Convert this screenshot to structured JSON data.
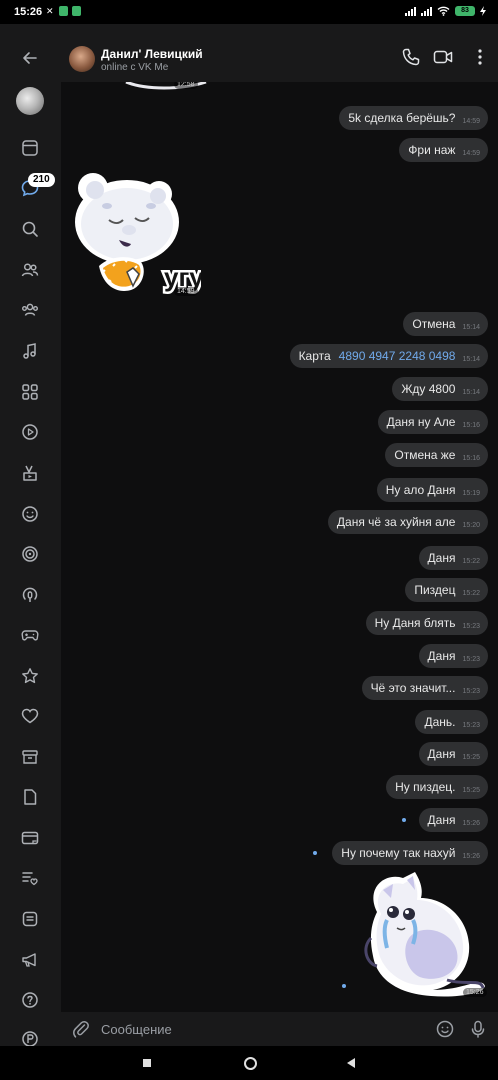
{
  "status_bar": {
    "time": "15:26",
    "battery": "83"
  },
  "sidebar": {
    "badge": "210"
  },
  "header": {
    "contact_name": "Данил' Левицкий",
    "contact_status": "online с VK Me"
  },
  "messages": [
    {
      "text": "5k сделка берёшь?",
      "time": "14:59"
    },
    {
      "text": "Фри наж",
      "time": "14:59"
    },
    {
      "text": "Отмена",
      "time": "15:14"
    },
    {
      "text": "Карта",
      "card": "4890 4947 2248 0498",
      "time": "15:14"
    },
    {
      "text": "Жду 4800",
      "time": "15:14"
    },
    {
      "text": "Даня ну Але",
      "time": "15:16"
    },
    {
      "text": "Отмена же",
      "time": "15:16"
    },
    {
      "text": "Ну ало Даня",
      "time": "15:19"
    },
    {
      "text": "Даня чё за хуйня але",
      "time": "15:20"
    },
    {
      "text": "Даня",
      "time": "15:22"
    },
    {
      "text": "Пиздец",
      "time": "15:22"
    },
    {
      "text": "Ну Даня блять",
      "time": "15:23"
    },
    {
      "text": "Даня",
      "time": "15:23"
    },
    {
      "text": "Чё это значит...",
      "time": "15:23"
    },
    {
      "text": "Дань.",
      "time": "15:23"
    },
    {
      "text": "Даня",
      "time": "15:25"
    },
    {
      "text": "Ну пиздец.",
      "time": "15:25"
    },
    {
      "text": "Даня",
      "time": "15:26"
    },
    {
      "text": "Ну почему так нахуй",
      "time": "15:26"
    }
  ],
  "stickers": {
    "top_partial_time": "12:58",
    "bear_text": "угу",
    "bear_time": "14:59",
    "cat_time": "15:26"
  },
  "composer": {
    "placeholder": "Сообщение"
  }
}
